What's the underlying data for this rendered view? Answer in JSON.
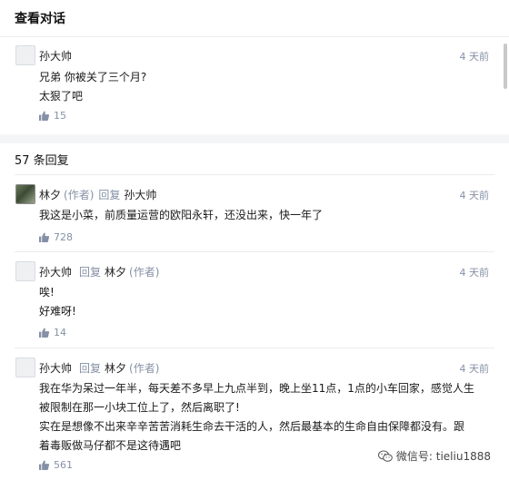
{
  "header": {
    "title": "查看对话"
  },
  "root_comment": {
    "author": "孙大帅",
    "time": "4 天前",
    "lines": [
      "兄弟 你被关了三个月?",
      "太狠了吧"
    ],
    "likes": "15"
  },
  "replies_header": "57 条回复",
  "replies": [
    {
      "author": "林夕",
      "author_role": "(作者)",
      "reply_word": "回复",
      "reply_to": "孙大帅",
      "reply_to_role": "",
      "time": "4 天前",
      "lines": [
        "我这是小菜，前质量运营的欧阳永轩，还没出来，快一年了"
      ],
      "likes": "728"
    },
    {
      "author": "孙大帅",
      "author_role": "",
      "reply_word": "回复",
      "reply_to": "林夕",
      "reply_to_role": "(作者)",
      "time": "4 天前",
      "lines": [
        "唉!",
        "好难呀!"
      ],
      "likes": "14"
    },
    {
      "author": "孙大帅",
      "author_role": "",
      "reply_word": "回复",
      "reply_to": "林夕",
      "reply_to_role": "(作者)",
      "time": "4 天前",
      "lines": [
        "我在华为呆过一年半，每天差不多早上九点半到，晚上坐11点，1点的小车回家，感觉人生",
        "被限制在那一小块工位上了，然后离职了!",
        "实在是想像不出来辛辛苦苦消耗生命去干活的人，然后最基本的生命自由保障都没有。跟",
        "着毒贩做马仔都不是这待遇吧"
      ],
      "likes": "561"
    }
  ],
  "watermark": {
    "text": "微信号: tieliu1888",
    "icon": "wechat-icon"
  }
}
